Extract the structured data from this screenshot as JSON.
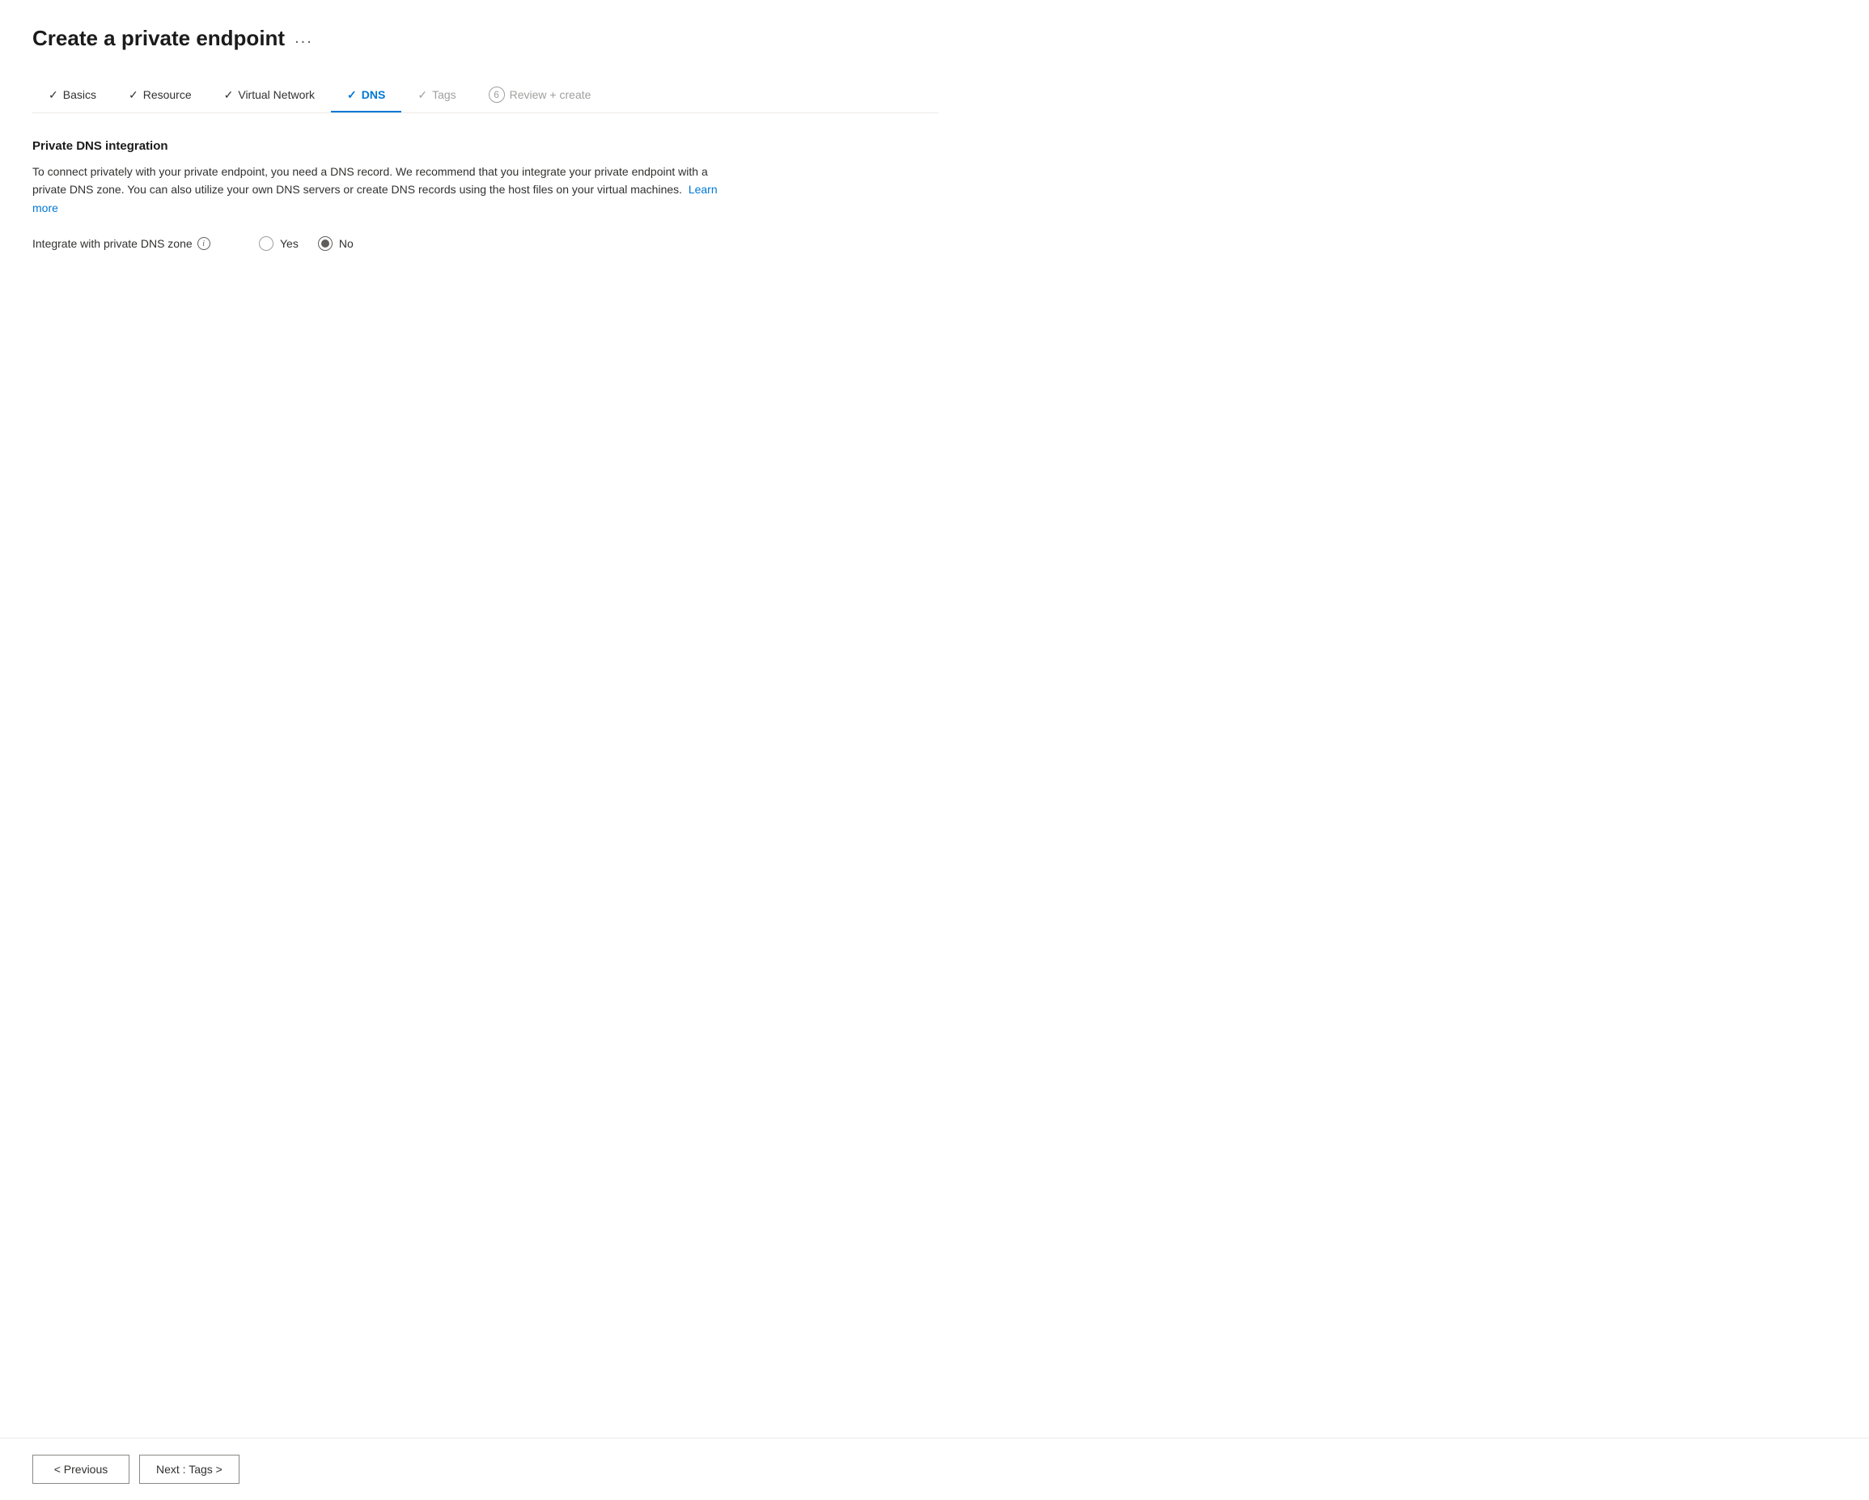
{
  "page": {
    "title": "Create a private endpoint",
    "ellipsis": "..."
  },
  "tabs": [
    {
      "id": "basics",
      "label": "Basics",
      "state": "completed",
      "icon": "check"
    },
    {
      "id": "resource",
      "label": "Resource",
      "state": "completed",
      "icon": "check"
    },
    {
      "id": "virtual-network",
      "label": "Virtual Network",
      "state": "completed",
      "icon": "check"
    },
    {
      "id": "dns",
      "label": "DNS",
      "state": "active",
      "icon": "check"
    },
    {
      "id": "tags",
      "label": "Tags",
      "state": "disabled",
      "icon": "check"
    },
    {
      "id": "review-create",
      "label": "Review + create",
      "state": "disabled",
      "number": "6"
    }
  ],
  "content": {
    "section_title": "Private DNS integration",
    "description_part1": "To connect privately with your private endpoint, you need a DNS record. We recommend that you integrate your private endpoint with a private DNS zone. You can also utilize your own DNS servers or create DNS records using the host files on your virtual machines.",
    "learn_more_label": "Learn more",
    "field_label": "Integrate with private DNS zone",
    "radio_yes_label": "Yes",
    "radio_no_label": "No",
    "selected_option": "no"
  },
  "footer": {
    "previous_label": "< Previous",
    "next_label": "Next : Tags >"
  }
}
